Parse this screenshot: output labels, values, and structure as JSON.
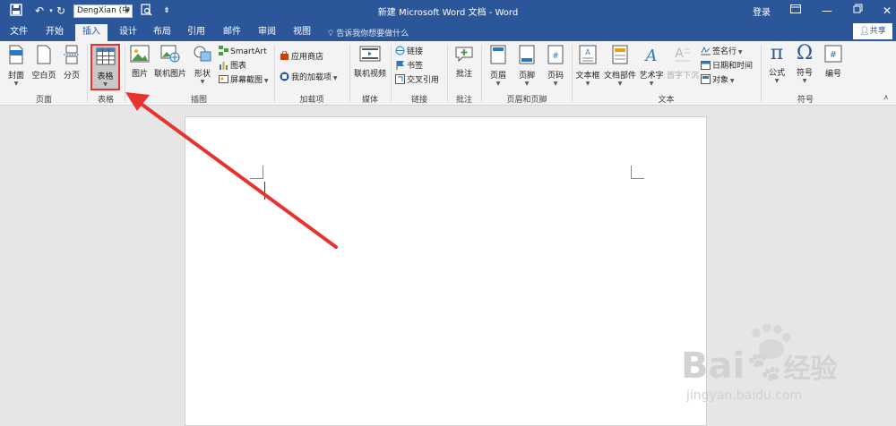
{
  "window": {
    "title": "新建 Microsoft Word 文档 - Word",
    "font_name": "DengXian (中",
    "login_label": "登录"
  },
  "tabs": [
    "文件",
    "开始",
    "插入",
    "设计",
    "布局",
    "引用",
    "邮件",
    "审阅",
    "视图"
  ],
  "active_tab": "插入",
  "tell_me_placeholder": "告诉我你想要做什么",
  "share_label": "共享",
  "ribbon": {
    "pages": {
      "cover": "封面",
      "blank": "空白页",
      "break": "分页",
      "group": "页面"
    },
    "tables": {
      "table": "表格",
      "group": "表格"
    },
    "illustrations": {
      "picture": "图片",
      "online_picture": "联机图片",
      "shapes": "形状",
      "smartart": "SmartArt",
      "chart": "图表",
      "screenshot": "屏幕截图",
      "group": "插图"
    },
    "addins": {
      "store": "应用商店",
      "my_addins": "我的加载项",
      "group": "加载项"
    },
    "media": {
      "online_video": "联机视频",
      "group": "媒体"
    },
    "links": {
      "link": "链接",
      "bookmark": "书签",
      "crossref": "交叉引用",
      "group": "链接"
    },
    "comments": {
      "comment": "批注",
      "group": "批注"
    },
    "header_footer": {
      "header": "页眉",
      "footer": "页脚",
      "page_number": "页码",
      "group": "页眉和页脚"
    },
    "text": {
      "textbox": "文本框",
      "quick_parts": "文档部件",
      "wordart": "艺术字",
      "dropcap": "首字下沉",
      "signature": "签名行",
      "datetime": "日期和时间",
      "object": "对象",
      "group": "文本"
    },
    "symbols": {
      "equation": "公式",
      "symbol": "符号",
      "numbering": "编号",
      "group": "符号"
    }
  },
  "watermark": {
    "brand": "Bai",
    "brand_cn": "经验",
    "url": "jingyan.baidu.com"
  },
  "colors": {
    "brand_blue": "#2b579a",
    "highlight_red": "#e8322f"
  }
}
